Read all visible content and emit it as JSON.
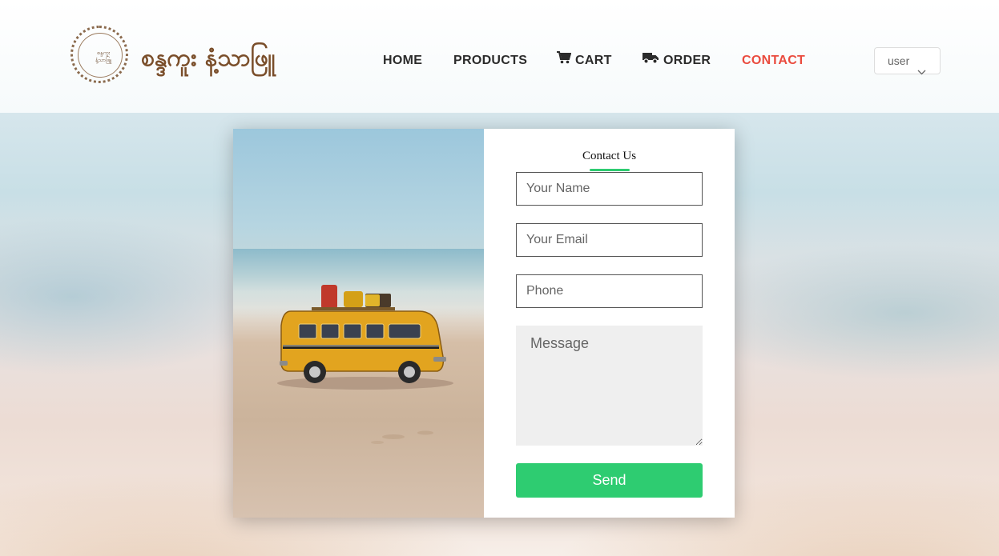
{
  "brand": {
    "logo_text": "စန္ဒကူး နံ့သာဖြူ",
    "logo_mini_text": "စန္ဒကူး နံ့သာဖြူ"
  },
  "nav": {
    "items": [
      {
        "label": "HOME",
        "icon": "none"
      },
      {
        "label": "PRODUCTS",
        "icon": "none"
      },
      {
        "label": "CART",
        "icon": "cart-icon"
      },
      {
        "label": "ORDER",
        "icon": "truck-icon"
      },
      {
        "label": "CONTACT",
        "icon": "none",
        "active": true
      }
    ],
    "active_color": "#ea4b3e"
  },
  "user_menu": {
    "label": "user"
  },
  "contact_form": {
    "title": "Contact Us",
    "name_placeholder": "Your Name",
    "email_placeholder": "Your Email",
    "phone_placeholder": "Phone",
    "message_placeholder": "Message",
    "send_label": "Send",
    "accent_color": "#2ecc71"
  }
}
